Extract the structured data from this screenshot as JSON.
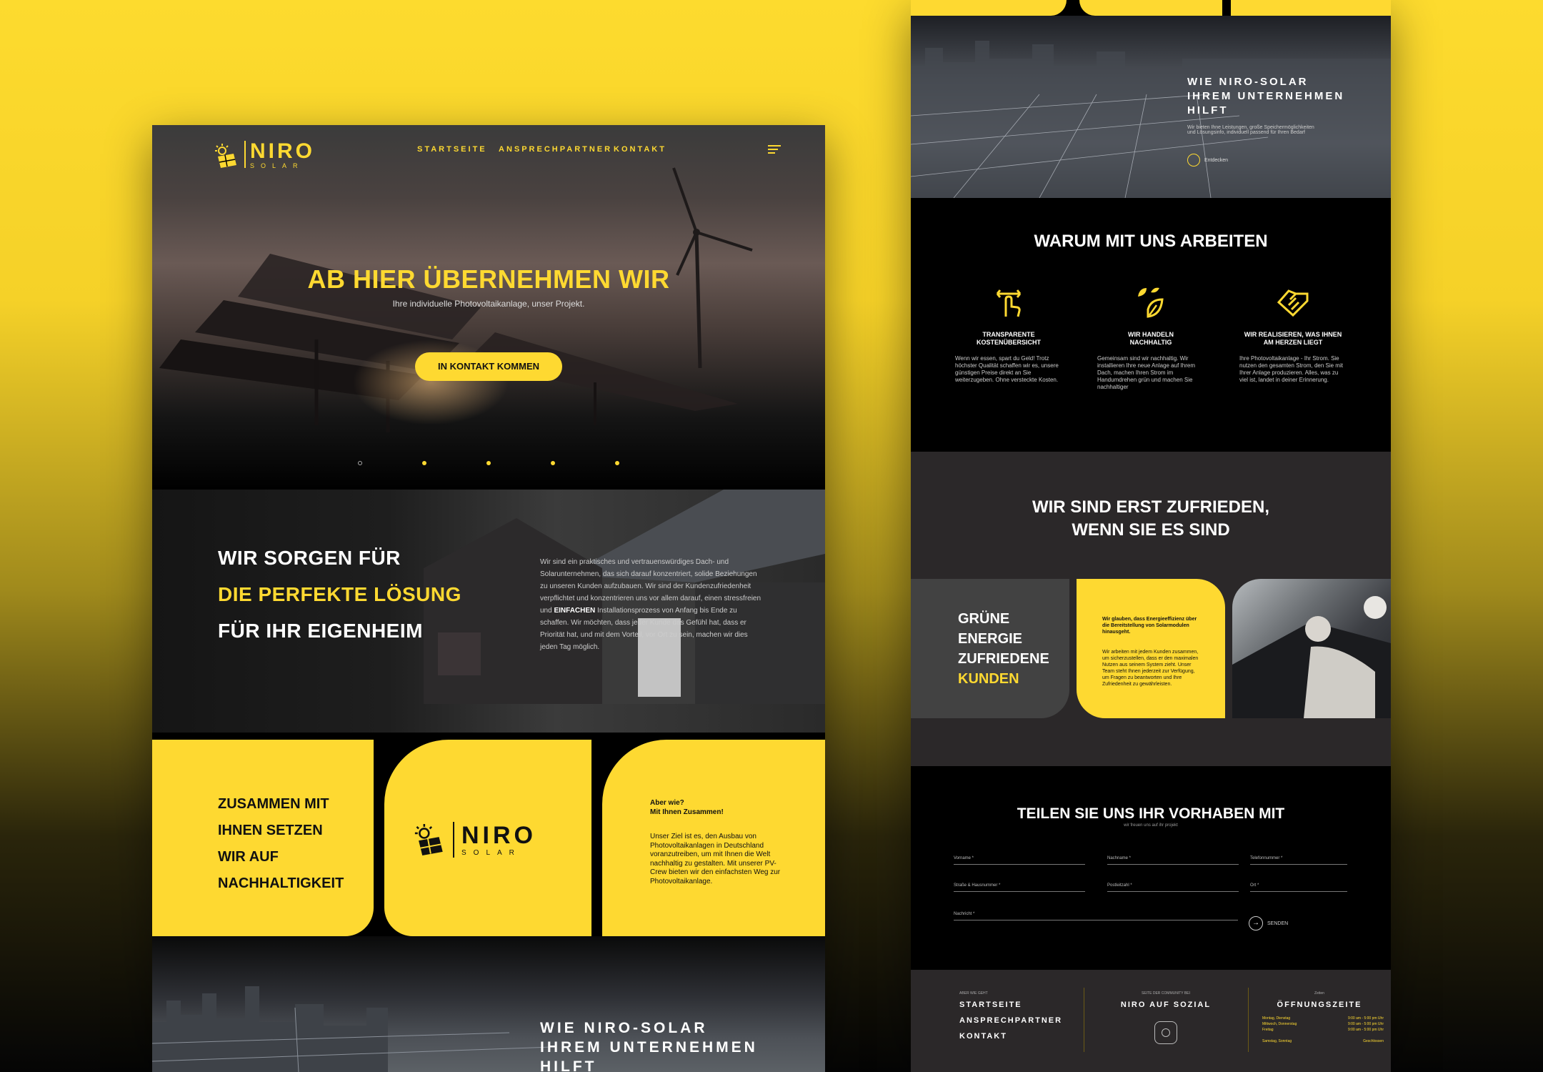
{
  "left": {
    "nav": {
      "logo_title": "NIRO",
      "logo_sub": "SOLAR",
      "links": [
        "STARTSEITE",
        "ANSPRECHPARTNER",
        "KONTAKT"
      ]
    },
    "hero": {
      "title": "AB HIER ÜBERNEHMEN WIR",
      "subtitle": "Ihre individuelle Photovoltaikanlage, unser Projekt.",
      "cta": "IN KONTAKT KOMMEN",
      "slides_total": 5,
      "slide_active": 1
    },
    "about": {
      "line1": "WIR SORGEN FÜR",
      "line2": "DIE PERFEKTE LÖSUNG",
      "line3": "FÜR IHR EIGENHEIM",
      "text_pre": "Wir sind ein praktisches und vertrauenswürdiges Dach- und Solarunternehmen, das sich darauf konzentriert, solide Beziehungen zu unseren Kunden aufzubauen. Wir sind der Kundenzufriedenheit verpflichtet und konzentrieren uns vor allem darauf, einen stressfreien und ",
      "text_bold": "EINFACHEN",
      "text_post": " Installationsprozess von Anfang bis Ende zu schaffen. Wir möchten, dass jeder Kunde das Gefühl hat, dass er Priorität hat, und mit dem Vorteil, vor Ort zu sein, machen wir dies jeden Tag möglich."
    },
    "cards": {
      "c1_lines": [
        "ZUSAMMEN MIT",
        "IHNEN SETZEN",
        "WIR AUF",
        "NACHHALTIGKEIT"
      ],
      "logo_title": "NIRO",
      "logo_sub": "SOLAR",
      "c3_q1": "Aber wie?",
      "c3_q2": "Mit Ihnen Zusammen!",
      "c3_p": "Unser Ziel ist es, den Ausbau von Photovoltaikanlagen in Deutschland voranzutreiben, um mit Ihnen die Welt nachhaltig zu gestalten. Mit unserer PV-Crew bieten wir den einfachsten Weg zur Photovoltaikanlage."
    },
    "city": {
      "lines": [
        "WIE NIRO-SOLAR",
        "IHREM UNTERNEHMEN",
        "HILFT"
      ]
    }
  },
  "right": {
    "city": {
      "lines": [
        "WIE NIRO-SOLAR",
        "IHREM UNTERNEHMEN",
        "HILFT"
      ],
      "text": "Wir bieten Ihne Leistungen, große Speichermöglichkeiten und Lösungsinfo, individuell passend für Ihren Bedarf",
      "discover": "Entdecken"
    },
    "why": {
      "title": "WARUM MIT UNS ARBEITEN",
      "features": [
        {
          "title1": "TRANSPARENTE",
          "title2": "KOSTENÜBERSICHT",
          "text": "Wenn wir essen, spart du Geld! Trotz höchster Qualität schaffen wir es, unsere günstigen Preise direkt an Sie weiterzugeben. Ohne versteckte Kosten.",
          "icon": "hand-pointer-icon"
        },
        {
          "title1": "WIR HANDELN",
          "title2": "NACHHALTIG",
          "text": "Gemeinsam sind wir nachhaltig. Wir installieren Ihre neue Anlage auf Ihrem Dach, machen Ihren Strom im Handumdrehen grün und machen Sie nachhaltiger",
          "icon": "leaf-icon"
        },
        {
          "title1": "WIR REALISIEREN, WAS IHNEN",
          "title2": "AM HERZEN LIEGT",
          "text": "Ihre Photovoltaikanlage - Ihr Strom. Sie nutzen den gesamten Strom, den Sie mit Ihrer Anlage produzieren. Alles, was zu viel ist, landet in deiner Erinnerung.",
          "icon": "handshake-icon"
        }
      ]
    },
    "zufrieden": {
      "title1": "WIR SIND ERST ZUFRIEDEN,",
      "title2": "WENN SIE ES SIND",
      "green_lines": [
        "GRÜNE",
        "ENERGIE",
        "ZUFRIEDENE"
      ],
      "green_yellow": "KUNDEN",
      "card_bold": "Wir glauben, dass Energieeffizienz über die Bereitstellung von Solarmodulen hinausgeht.",
      "card_text": "Wir arbeiten mit jedem Kunden zusammen, um sicherzustellen, dass er den maximalen Nutzen aus seinem System zieht. Unser Team steht Ihnen jederzeit zur Verfügung, um Fragen zu beantworten und Ihre Zufriedenheit zu gewährleisten."
    },
    "form": {
      "title": "TEILEN SIE UNS IHR VORHABEN MIT",
      "subtitle": "wir freuen uns auf ihr projekt",
      "fields": [
        "Vorname *",
        "Nachname *",
        "Telefonnummer *",
        "Straße & Hausnummer *",
        "Postleitzahl *",
        "Ort *",
        "Nachricht *"
      ],
      "send": "SENDEN"
    },
    "footer": {
      "col1_small": "ABER WIE GEHT",
      "links": [
        "STARTSEITE",
        "ANSPRECHPARTNER",
        "KONTAKT"
      ],
      "col2_small": "SEITE DER COMMUNITY BEI",
      "social_title": "NIRO AUF SOZIAL",
      "col3_small": "Zeiten",
      "hours_title": "ÖFFNUNGSZEITE",
      "hours": [
        {
          "day": "Montag, Dienstag",
          "time": "9:00 am - 5:00 pm Uhr"
        },
        {
          "day": "Mittwoch, Donnerstag",
          "time": "9:00 am - 5:00 pm Uhr"
        },
        {
          "day": "Freitag",
          "time": "9:00 am - 5:00 pm Uhr"
        },
        {
          "day": "Samstag, Sonntag",
          "time": "Geschlossen"
        }
      ]
    }
  },
  "colors": {
    "brand_yellow": "#fed931",
    "dark": "#000000",
    "grey": "#2b2829"
  }
}
